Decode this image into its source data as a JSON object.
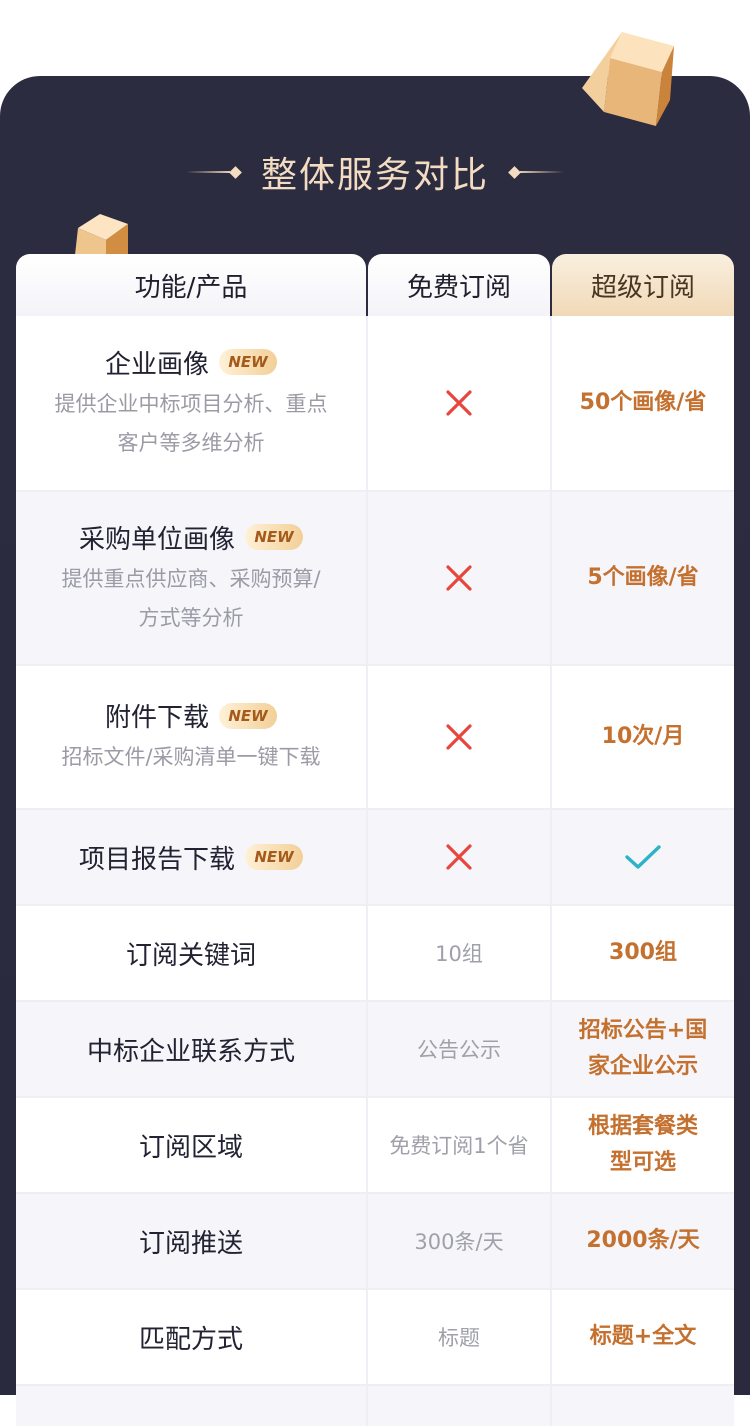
{
  "section_title": "整体服务对比",
  "header": {
    "feature": "功能/产品",
    "free": "免费订阅",
    "super": "超级订阅"
  },
  "badge_label": "NEW",
  "rows": [
    {
      "title": "企业画像",
      "desc_1": "提供企业中标项目分析、重点",
      "desc_2": "客户等多维分析",
      "free_icon": "cross-icon",
      "super": "50个画像/省"
    },
    {
      "title": "采购单位画像",
      "desc_1": "提供重点供应商、采购预算/",
      "desc_2": "方式等分析",
      "free_icon": "cross-icon",
      "super": "5个画像/省"
    },
    {
      "title": "附件下载",
      "desc_1": "招标文件/采购清单一键下载",
      "free_icon": "cross-icon",
      "super": "10次/月"
    },
    {
      "title": "项目报告下载",
      "free_icon": "cross-icon",
      "super_icon": "check-icon"
    },
    {
      "title": "订阅关键词",
      "free": "10组",
      "super": "300组"
    },
    {
      "title": "中标企业联系方式",
      "free": "公告公示",
      "super_1": "招标公告+国",
      "super_2": "家企业公示"
    },
    {
      "title": "订阅区域",
      "free": "免费订阅1个省",
      "super_1": "根据套餐类",
      "super_2": "型可选"
    },
    {
      "title": "订阅推送",
      "free": "300条/天",
      "super": "2000条/天"
    },
    {
      "title": "匹配方式",
      "free": "标题",
      "super": "标题+全文"
    }
  ],
  "colors": {
    "panel": "#2c2c40",
    "accent": "#c4702f",
    "cross": "#e8463c",
    "check": "#2bb3c7",
    "title": "#f3dcc1"
  }
}
